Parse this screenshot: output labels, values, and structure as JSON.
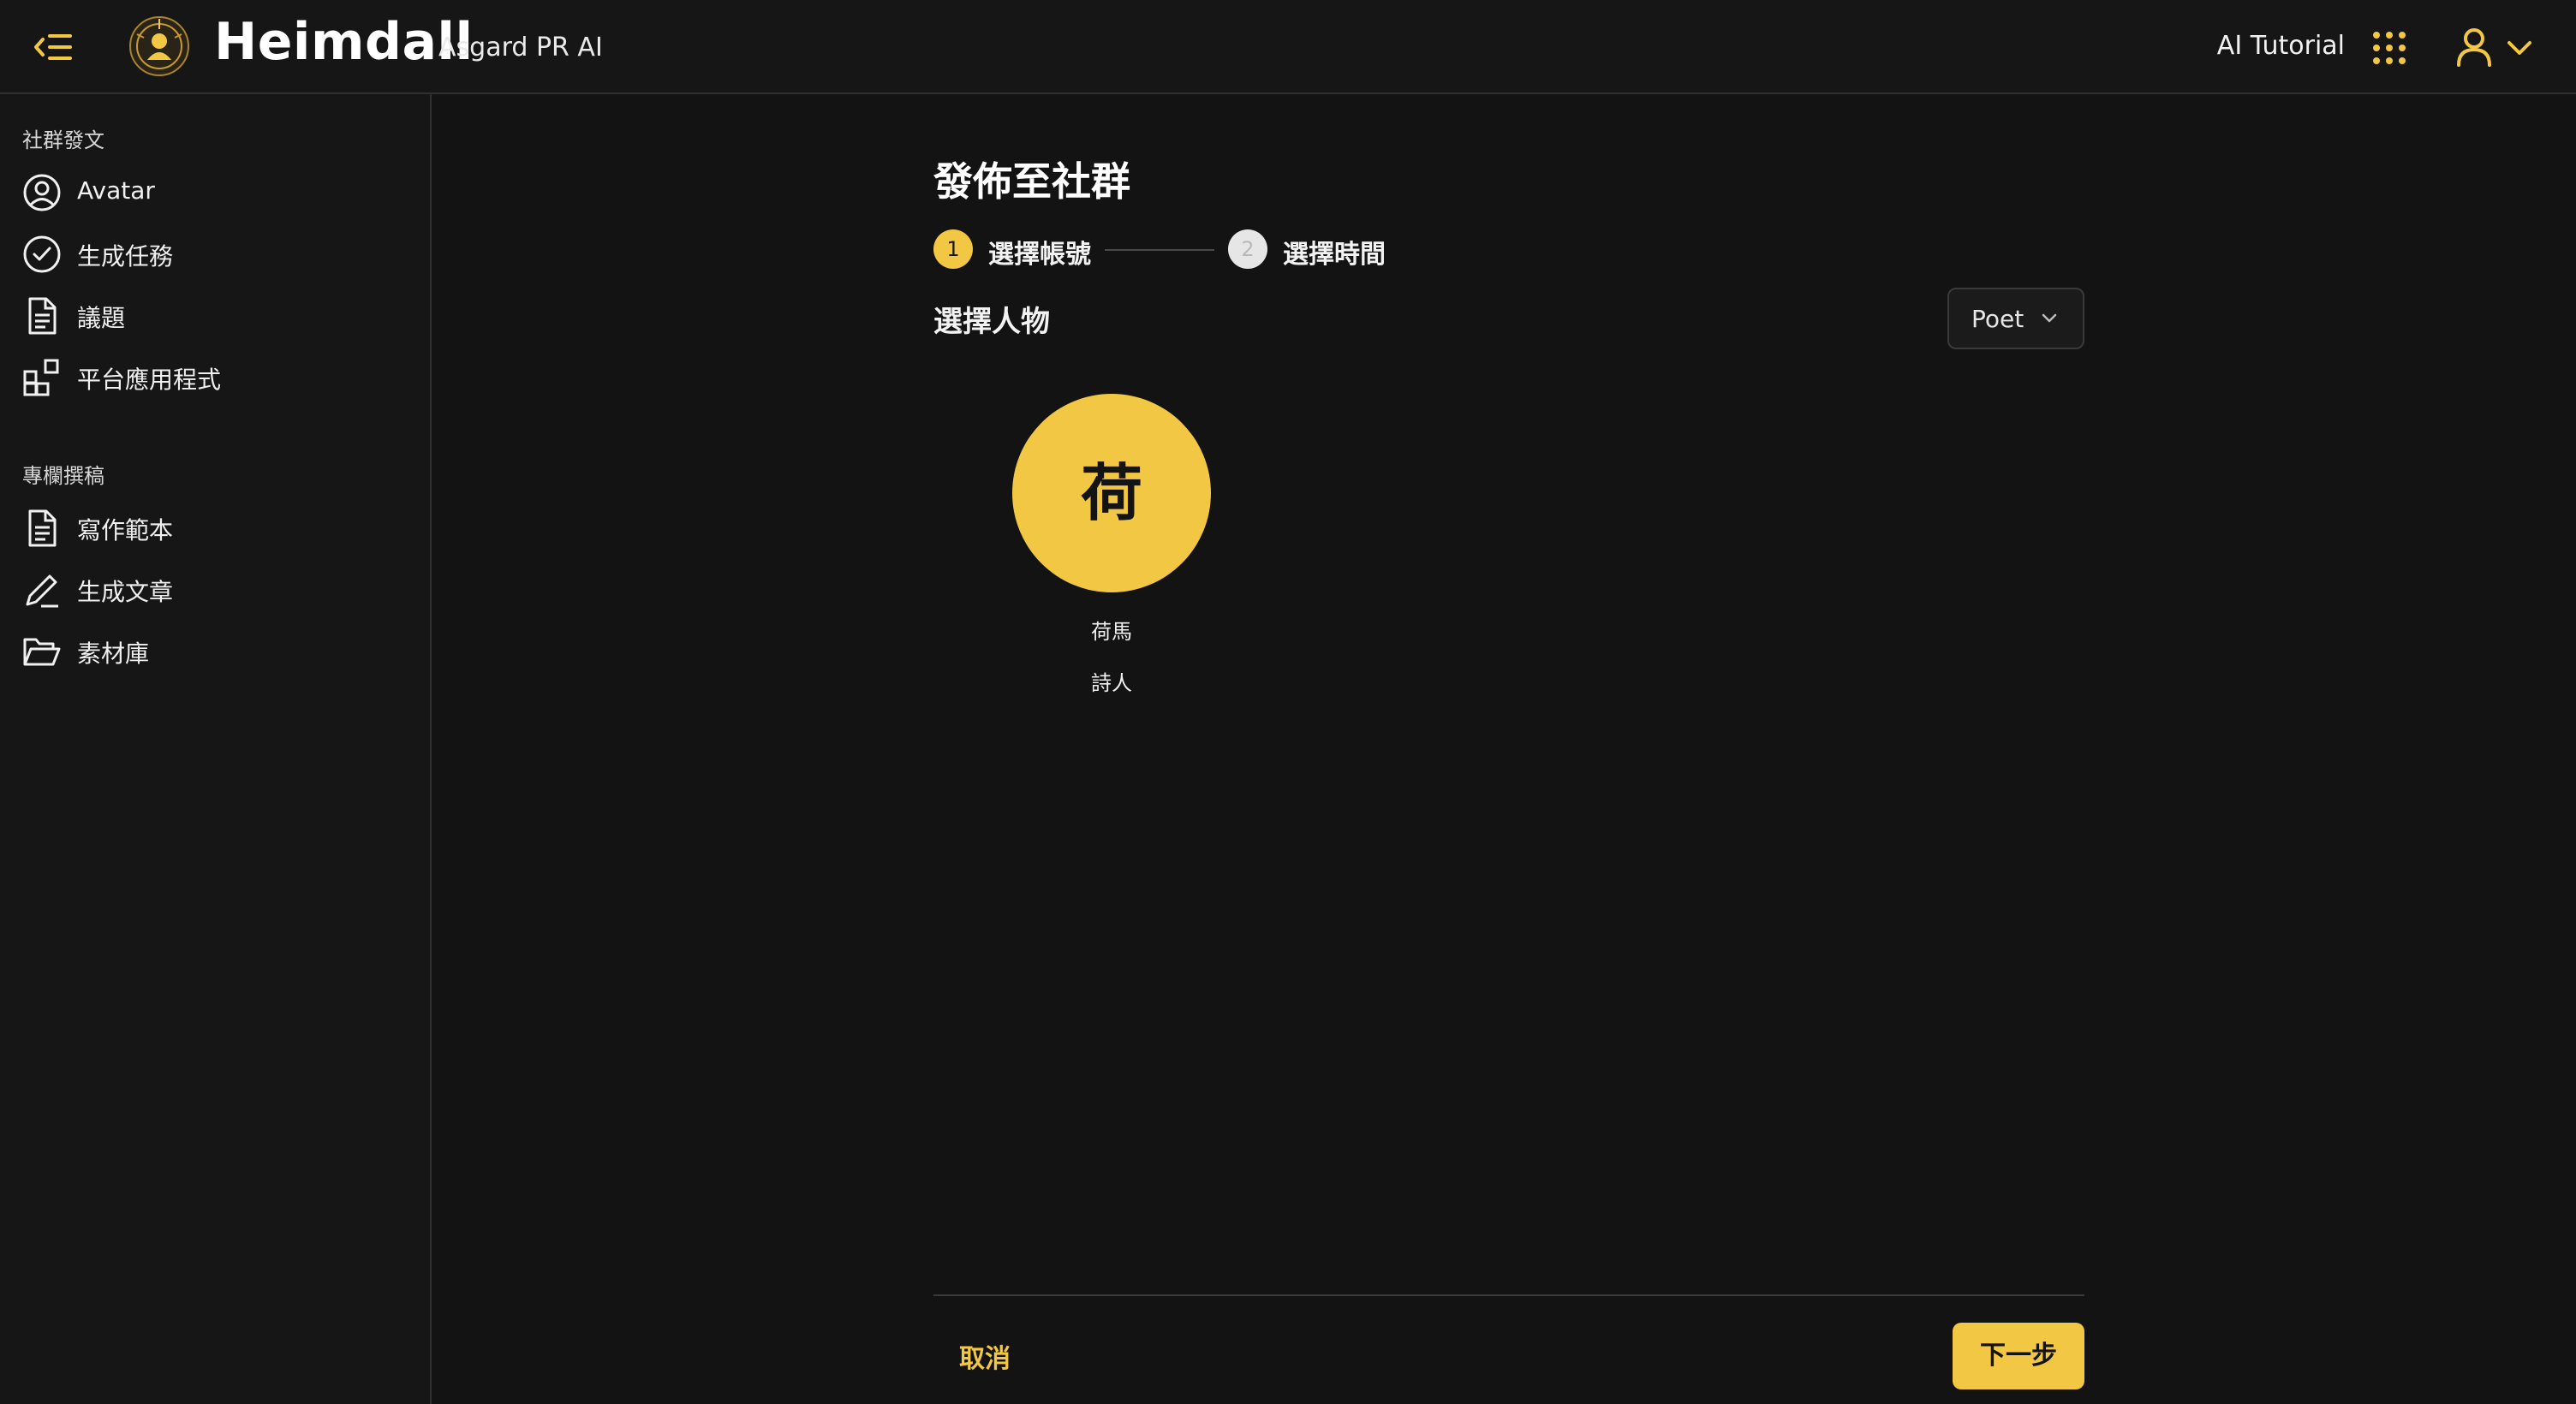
{
  "header": {
    "title": "Heimdall",
    "subtitle": "Asgard PR AI",
    "tutorial_label": "AI Tutorial",
    "icons": {
      "collapse": "menu-collapse-icon",
      "logo": "heimdall-logo",
      "apps": "apps-grid-icon",
      "user": "user-icon",
      "chevron": "chevron-down-icon"
    }
  },
  "sidebar": {
    "sections": [
      {
        "label": "社群發文",
        "items": [
          {
            "label": "Avatar",
            "icon": "user-circle-icon"
          },
          {
            "label": "生成任務",
            "icon": "check-circle-icon"
          },
          {
            "label": "議題",
            "icon": "document-icon"
          },
          {
            "label": "平台應用程式",
            "icon": "apps-add-icon"
          }
        ]
      },
      {
        "label": "專欄撰稿",
        "items": [
          {
            "label": "寫作範本",
            "icon": "document-icon"
          },
          {
            "label": "生成文章",
            "icon": "pen-icon"
          },
          {
            "label": "素材庫",
            "icon": "folder-open-icon"
          }
        ]
      }
    ]
  },
  "main": {
    "title": "發佈至社群",
    "steps": [
      {
        "number": "1",
        "label": "選擇帳號",
        "active": true
      },
      {
        "number": "2",
        "label": "選擇時間",
        "active": false
      }
    ],
    "section_heading": "選擇人物",
    "filter": {
      "value": "Poet"
    },
    "personas": [
      {
        "avatar_text": "荷",
        "name": "荷馬",
        "role": "詩人"
      }
    ],
    "cancel_label": "取消",
    "next_label": "下一步"
  },
  "colors": {
    "accent": "#f2c744",
    "background": "#131313",
    "panel": "#161616",
    "border": "#303030"
  }
}
